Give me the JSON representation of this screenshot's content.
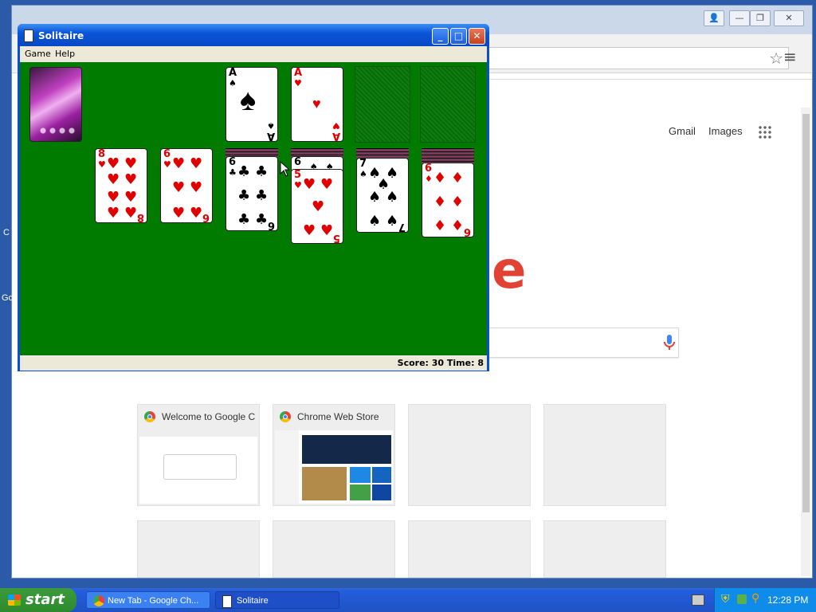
{
  "chrome": {
    "window_controls": {
      "user": "👤",
      "minimize": "—",
      "maximize": "❐",
      "close": "✕"
    },
    "star_icon": "☆",
    "menu_icon": "≡",
    "links": {
      "gmail": "Gmail",
      "images": "Images"
    },
    "logo_fragment": "e",
    "tiles": [
      {
        "title": "Welcome to Google C",
        "thumb": "welcome"
      },
      {
        "title": "Chrome Web Store",
        "thumb": "store"
      },
      {
        "title": "",
        "thumb": ""
      },
      {
        "title": "",
        "thumb": ""
      }
    ],
    "left_clip_text": [
      "C",
      "Go"
    ]
  },
  "solitaire": {
    "title": "Solitaire",
    "menu": {
      "game": "Game",
      "help": "Help"
    },
    "buttons": {
      "minimize": "_",
      "maximize": "□",
      "close": "✕"
    },
    "status": "Score: 30 Time: 8",
    "foundations": [
      {
        "rank": "A",
        "suit": "♠",
        "color": "black"
      },
      {
        "rank": "A",
        "suit": "♥",
        "color": "red"
      },
      {
        "rank": "",
        "suit": "",
        "color": ""
      },
      {
        "rank": "",
        "suit": "",
        "color": ""
      }
    ],
    "tableau": [
      {
        "cards": []
      },
      {
        "cards": [
          {
            "rank": "8",
            "suit": "♥",
            "color": "red"
          }
        ]
      },
      {
        "cards": [
          {
            "rank": "6",
            "suit": "♥",
            "color": "red"
          }
        ]
      },
      {
        "cards": [
          {
            "rank": "6",
            "suit": "♣",
            "color": "black"
          }
        ]
      },
      {
        "cards": [
          {
            "rank": "6",
            "suit": "♠",
            "color": "black"
          },
          {
            "rank": "5",
            "suit": "♥",
            "color": "red"
          }
        ]
      },
      {
        "cards": [
          {
            "rank": "7",
            "suit": "♠",
            "color": "black"
          }
        ]
      },
      {
        "cards": [
          {
            "rank": "6",
            "suit": "♦",
            "color": "red"
          }
        ]
      }
    ]
  },
  "taskbar": {
    "start": "start",
    "tasks": [
      "New Tab - Google Ch...",
      "Solitaire"
    ],
    "clock": "12:28 PM"
  }
}
